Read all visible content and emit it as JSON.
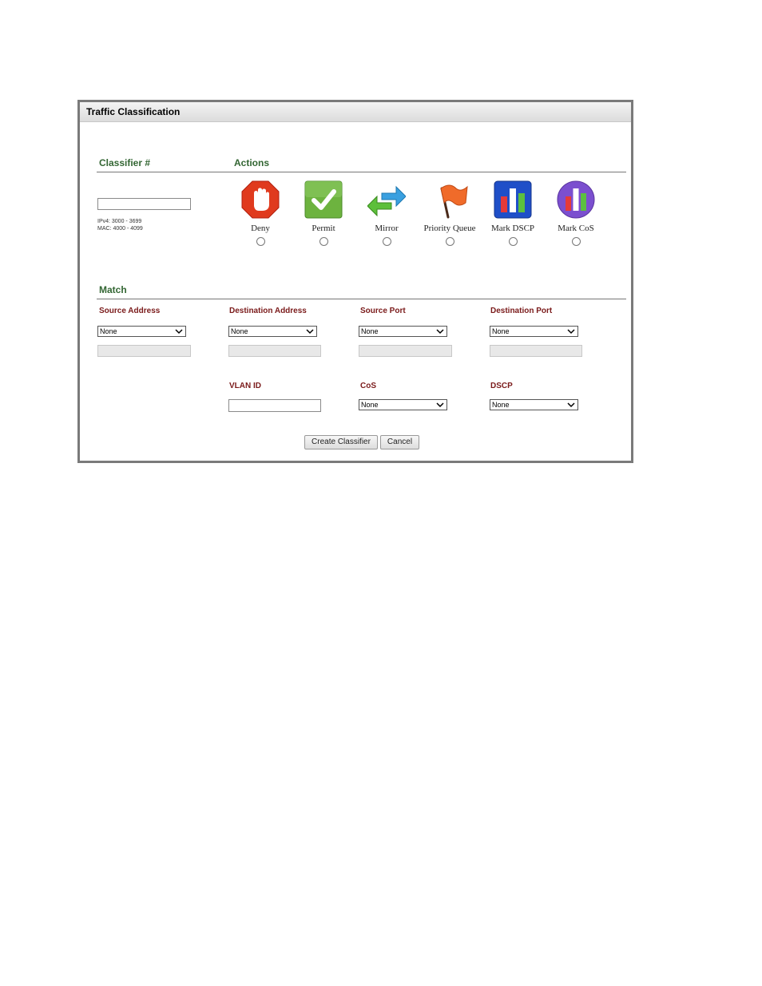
{
  "panel": {
    "title": "Traffic Classification"
  },
  "classifier": {
    "title": "Classifier #",
    "value": "",
    "hint_ipv4": "IPv4: 3000 - 3699",
    "hint_mac": "MAC: 4000 - 4099"
  },
  "actions": {
    "title": "Actions",
    "items": [
      {
        "label": "Deny",
        "icon": "deny-hand-icon",
        "color": "#e03a1e"
      },
      {
        "label": "Permit",
        "icon": "check-icon",
        "color": "#6db33f"
      },
      {
        "label": "Mirror",
        "icon": "mirror-arrows-icon",
        "color": "#3aa0e0"
      },
      {
        "label": "Priority Queue",
        "icon": "flag-icon",
        "color": "#f06b2a"
      },
      {
        "label": "Mark DSCP",
        "icon": "bar-chart-icon",
        "color": "#1f4fc8"
      },
      {
        "label": "Mark CoS",
        "icon": "bar-chart-circle-icon",
        "color": "#7b4fcf"
      }
    ]
  },
  "match": {
    "title": "Match",
    "source_address": {
      "label": "Source Address",
      "selected": "None"
    },
    "destination_address": {
      "label": "Destination Address",
      "selected": "None"
    },
    "source_port": {
      "label": "Source Port",
      "selected": "None"
    },
    "destination_port": {
      "label": "Destination Port",
      "selected": "None"
    },
    "vlan_id": {
      "label": "VLAN ID",
      "value": ""
    },
    "cos": {
      "label": "CoS",
      "selected": "None"
    },
    "dscp": {
      "label": "DSCP",
      "selected": "None"
    }
  },
  "buttons": {
    "create": "Create Classifier",
    "cancel": "Cancel"
  }
}
